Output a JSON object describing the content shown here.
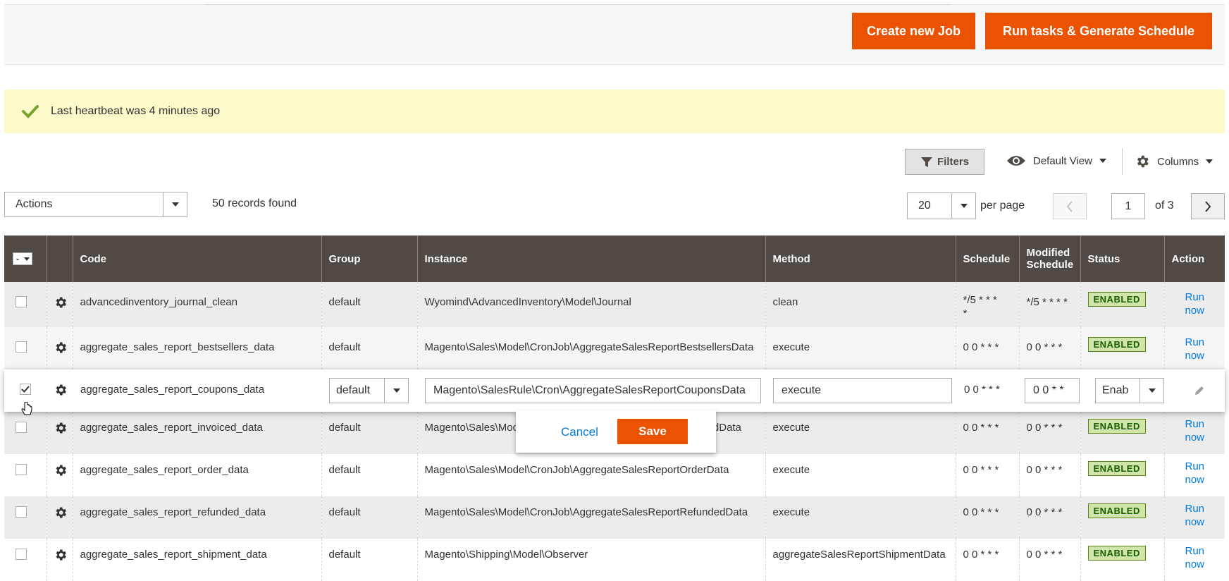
{
  "header": {
    "create_job_label": "Create new Job",
    "run_tasks_label": "Run tasks & Generate Schedule"
  },
  "notice": {
    "message": "Last heartbeat was 4 minutes ago"
  },
  "toolbar": {
    "filters_label": "Filters",
    "view_label": "Default View",
    "columns_label": "Columns"
  },
  "grid_controls": {
    "actions_label": "Actions",
    "records_found": "50 records found",
    "per_page_value": "20",
    "per_page_label": "per page",
    "current_page": "1",
    "of_pages": "of 3"
  },
  "table": {
    "mass_select_label": "-",
    "columns": [
      "Code",
      "Group",
      "Instance",
      "Method",
      "Schedule",
      "Modified Schedule",
      "Status",
      "Action"
    ],
    "modified_schedule_line1": "Modified",
    "modified_schedule_line2": "Schedule",
    "rows": [
      {
        "code": "advancedinventory_journal_clean",
        "group": "default",
        "instance": "Wyomind\\AdvancedInventory\\Model\\Journal",
        "method": "clean",
        "schedule_l1": "*/5 * * *",
        "schedule_l2": "*",
        "modified": "*/5 * * * *",
        "status": "ENABLED",
        "action_l1": "Run",
        "action_l2": "now"
      },
      {
        "code": "aggregate_sales_report_bestsellers_data",
        "group": "default",
        "instance": "Magento\\Sales\\Model\\CronJob\\AggregateSalesReportBestsellersData",
        "method": "execute",
        "schedule_l1": "0 0 * * *",
        "schedule_l2": "",
        "modified": "0 0 * * *",
        "status": "ENABLED",
        "action_l1": "Run",
        "action_l2": "now"
      },
      {
        "code": "aggregate_sales_report_invoiced_data",
        "group": "default",
        "instance": "Magento\\Sales\\Model\\CronJob\\AggregateSalesReportInvoicedData",
        "method": "execute",
        "schedule_l1": "0 0 * * *",
        "schedule_l2": "",
        "modified": "0 0 * * *",
        "status": "ENABLED",
        "action_l1": "Run",
        "action_l2": "now"
      },
      {
        "code": "aggregate_sales_report_order_data",
        "group": "default",
        "instance": "Magento\\Sales\\Model\\CronJob\\AggregateSalesReportOrderData",
        "method": "execute",
        "schedule_l1": "0 0 * * *",
        "schedule_l2": "",
        "modified": "0 0 * * *",
        "status": "ENABLED",
        "action_l1": "Run",
        "action_l2": "now"
      },
      {
        "code": "aggregate_sales_report_refunded_data",
        "group": "default",
        "instance": "Magento\\Sales\\Model\\CronJob\\AggregateSalesReportRefundedData",
        "method": "execute",
        "schedule_l1": "0 0 * * *",
        "schedule_l2": "",
        "modified": "0 0 * * *",
        "status": "ENABLED",
        "action_l1": "Run",
        "action_l2": "now"
      },
      {
        "code": "aggregate_sales_report_shipment_data",
        "group": "default",
        "instance": "Magento\\Shipping\\Model\\Observer",
        "method": "aggregateSalesReportShipmentData",
        "schedule_l1": "0 0 * * *",
        "schedule_l2": "",
        "modified": "0 0 * * *",
        "status": "ENABLED",
        "action_l1": "Run",
        "action_l2": "now"
      }
    ],
    "editing_row": {
      "code": "aggregate_sales_report_coupons_data",
      "group_value": "default",
      "instance_value": "Magento\\SalesRule\\Cron\\AggregateSalesReportCouponsData",
      "method_value": "execute",
      "schedule": "0 0 * * *",
      "modified_value": "0 0 * *",
      "status_value": "Enab"
    }
  },
  "inline_edit": {
    "cancel_label": "Cancel",
    "save_label": "Save"
  },
  "colors": {
    "accent": "#eb5202",
    "header_bg": "#514943",
    "notice_bg": "#fcfaca",
    "link": "#007bdb",
    "badge_bg": "#d0e5a9"
  }
}
